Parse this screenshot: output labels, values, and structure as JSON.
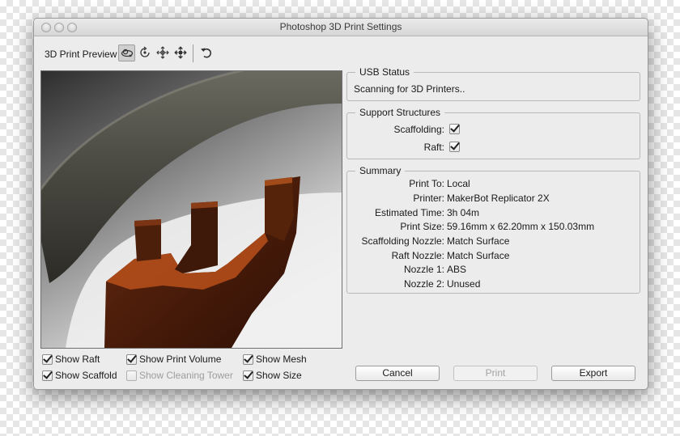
{
  "window": {
    "title": "Photoshop 3D Print Settings"
  },
  "toolbar": {
    "label": "3D Print Preview",
    "tools": [
      "orbit-3d-icon",
      "roll-3d-icon",
      "pan-3d-icon",
      "slide-3d-icon",
      "reset-view-icon"
    ]
  },
  "preview_options": {
    "show_raft": {
      "label": "Show Raft",
      "checked": true
    },
    "show_scaffold": {
      "label": "Show Scaffold",
      "checked": true
    },
    "show_print_volume": {
      "label": "Show Print Volume",
      "checked": true
    },
    "show_cleaning_tower": {
      "label": "Show Cleaning Tower",
      "checked": false,
      "enabled": false
    },
    "show_mesh": {
      "label": "Show Mesh",
      "checked": true
    },
    "show_size": {
      "label": "Show Size",
      "checked": true
    }
  },
  "usb_status": {
    "title": "USB Status",
    "text": "Scanning for 3D Printers.."
  },
  "support_structures": {
    "title": "Support Structures",
    "scaffolding": {
      "label": "Scaffolding:",
      "checked": true
    },
    "raft": {
      "label": "Raft:",
      "checked": true
    }
  },
  "summary": {
    "title": "Summary",
    "rows": [
      {
        "label": "Print To:",
        "value": "Local"
      },
      {
        "label": "Printer:",
        "value": "MakerBot Replicator 2X"
      },
      {
        "label": "Estimated Time:",
        "value": "3h 04m"
      },
      {
        "label": "Print Size:",
        "value": "59.16mm x 62.20mm x 150.03mm"
      },
      {
        "label": "Scaffolding Nozzle:",
        "value": "Match Surface"
      },
      {
        "label": "Raft Nozzle:",
        "value": "Match Surface"
      },
      {
        "label": "Nozzle 1:",
        "value": "ABS"
      },
      {
        "label": "Nozzle 2:",
        "value": "Unused"
      }
    ]
  },
  "buttons": {
    "cancel": "Cancel",
    "print": "Print",
    "export": "Export"
  }
}
